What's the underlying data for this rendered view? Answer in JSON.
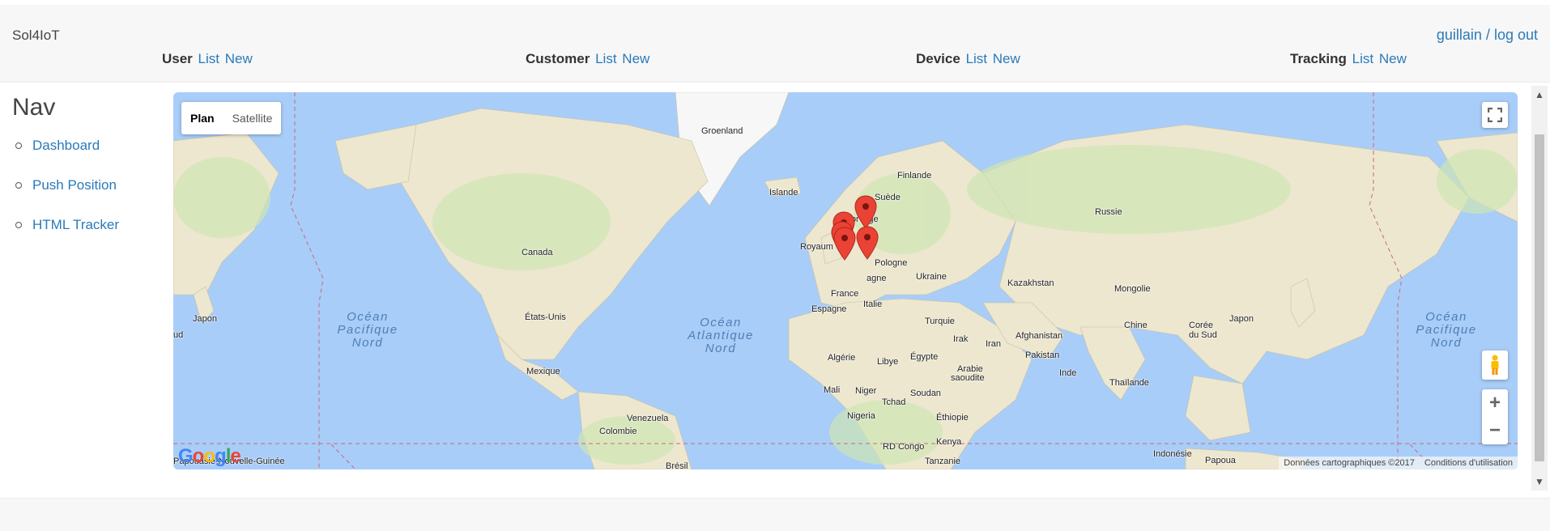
{
  "brand": "Sol4IoT",
  "user": {
    "name": "guillain",
    "separator": "/",
    "logout": "log out"
  },
  "menu": [
    {
      "title": "User",
      "list": "List",
      "new": "New"
    },
    {
      "title": "Customer",
      "list": "List",
      "new": "New"
    },
    {
      "title": "Device",
      "list": "List",
      "new": "New"
    },
    {
      "title": "Tracking",
      "list": "List",
      "new": "New"
    }
  ],
  "sidebar": {
    "title": "Nav",
    "items": [
      {
        "label": "Dashboard"
      },
      {
        "label": "Push Position"
      },
      {
        "label": "HTML Tracker"
      }
    ]
  },
  "map": {
    "type_buttons": {
      "active": "Plan",
      "inactive": "Satellite"
    },
    "country_labels": {
      "groenland": "Groenland",
      "islande": "Islande",
      "finlande": "Finlande",
      "suede": "Suède",
      "norvege": "Norvège",
      "royaume": "Royaum",
      "pologne": "Pologne",
      "allemagne": "agne",
      "ukraine": "Ukraine",
      "france": "France",
      "espagne": "Espagne",
      "italie": "Italie",
      "russie": "Russie",
      "kazakhstan": "Kazakhstan",
      "mongolie": "Mongolie",
      "chine": "Chine",
      "coree": "Corée du Sud",
      "japon_right": "Japon",
      "japon_left": "Japon",
      "sud": "ud",
      "turquie": "Turquie",
      "irak": "Irak",
      "iran": "Iran",
      "afghanistan": "Afghanistan",
      "pakistan": "Pakistan",
      "inde": "Inde",
      "thailande": "Thaïlande",
      "arabie": "Arabie",
      "saoudite": "saoudite",
      "egypte": "Égypte",
      "libye": "Libye",
      "algerie": "Algérie",
      "mali": "Mali",
      "niger": "Niger",
      "tchad": "Tchad",
      "soudan": "Soudan",
      "ethiopie": "Éthiopie",
      "nigeria": "Nigeria",
      "kenya": "Kenya",
      "rdcongo": "RD Congo",
      "tanzanie": "Tanzanie",
      "canada": "Canada",
      "etatsunis": "États-Unis",
      "mexique": "Mexique",
      "venezuela": "Venezuela",
      "colombie": "Colombie",
      "bresil": "Brésil",
      "indonesie": "Indonésie",
      "papouasie": "Papouasie-Nouvelle-Guinée",
      "papoua": "Papoua"
    },
    "ocean_labels": {
      "pacific_left": "Océan\nPacifique\nNord",
      "atlantic": "Océan\nAtlantique\nNord",
      "pacific_right": "Océan\nPacifique\nNord"
    },
    "markers": [
      "marker",
      "marker",
      "marker",
      "marker",
      "marker"
    ],
    "logo": "Google",
    "attribution": "Données cartographiques ©2017",
    "terms": "Conditions d'utilisation",
    "zoom_in": "+",
    "zoom_out": "−"
  },
  "colors": {
    "link": "#2a7ab9",
    "ocean": "#a8cdf8",
    "land": "#f0ead2",
    "marker": "#ea4335"
  }
}
